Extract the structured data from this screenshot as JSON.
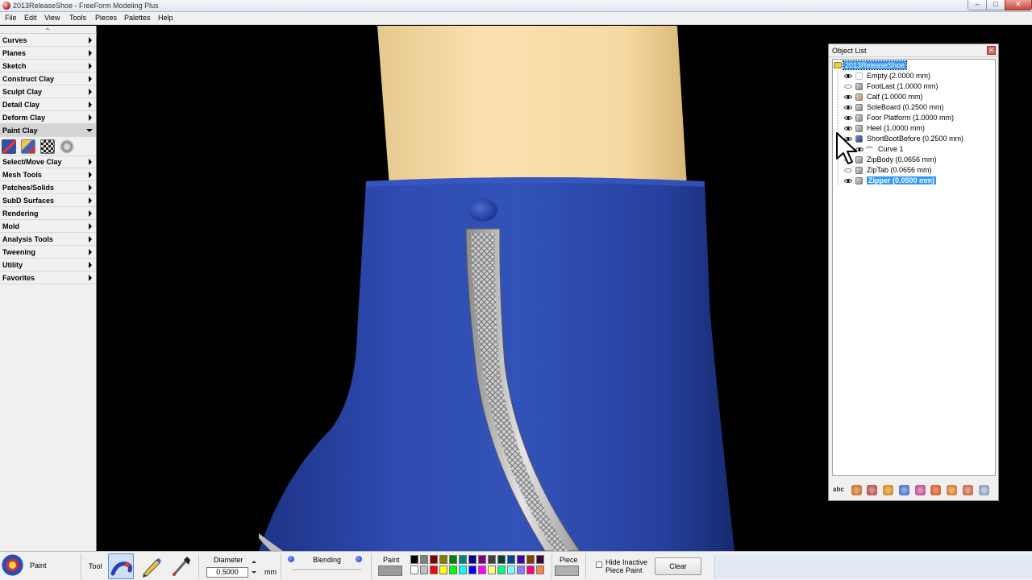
{
  "window": {
    "title": "2013ReleaseShoe - FreeForm Modeling Plus"
  },
  "menu": [
    "File",
    "Edit",
    "View",
    "Tools",
    "Pieces",
    "Palettes",
    "Help"
  ],
  "palette_menu": [
    {
      "label": "Curves"
    },
    {
      "label": "Planes"
    },
    {
      "label": "Sketch"
    },
    {
      "label": "Construct Clay"
    },
    {
      "label": "Sculpt Clay"
    },
    {
      "label": "Detail Clay"
    },
    {
      "label": "Deform Clay"
    },
    {
      "label": "Paint Clay"
    },
    {
      "label": "Select/Move Clay"
    },
    {
      "label": "Mesh Tools"
    },
    {
      "label": "Patches/Solids"
    },
    {
      "label": "SubD Surfaces"
    },
    {
      "label": "Rendering"
    },
    {
      "label": "Mold"
    },
    {
      "label": "Analysis Tools"
    },
    {
      "label": "Tweening"
    },
    {
      "label": "Utility"
    },
    {
      "label": "Favorites"
    }
  ],
  "object_list": {
    "title": "Object List",
    "root": "2013ReleaseShoe",
    "items": [
      {
        "name": "Empty (2.0000 mm)",
        "visible": true
      },
      {
        "name": "FootLast (1.0000 mm)",
        "visible": false
      },
      {
        "name": "Calf (1.0000 mm)",
        "visible": true
      },
      {
        "name": "SoleBoard (0.2500 mm)",
        "visible": true
      },
      {
        "name": "Foor Platform (1.0000 mm)",
        "visible": true
      },
      {
        "name": "Heel (1.0000 mm)",
        "visible": true
      },
      {
        "name": "ShortBootBefore (0.2500 mm)",
        "visible": true
      },
      {
        "name": "Curve 1",
        "visible": true
      },
      {
        "name": "ZipBody (0.0656 mm)",
        "visible": false
      },
      {
        "name": "ZipTab (0.0656 mm)",
        "visible": false
      },
      {
        "name": "Zipper (0.0500 mm)",
        "visible": true
      }
    ],
    "toolbar_text": "abc"
  },
  "bottom": {
    "paint_label": "Paint",
    "tool_label": "Tool",
    "diameter_label": "Diameter",
    "diameter_value": "0.5000",
    "unit": "mm",
    "blending_label": "Blending",
    "paint_color_label": "Paint",
    "piece_label": "Piece",
    "hide_inactive_line1": "Hide Inactive",
    "hide_inactive_line2": "Piece Paint",
    "clear_label": "Clear"
  },
  "colors": {
    "boot_blue": "#2b45a8",
    "calf_tan": "#f2d49b",
    "selection": "#3399ff"
  }
}
